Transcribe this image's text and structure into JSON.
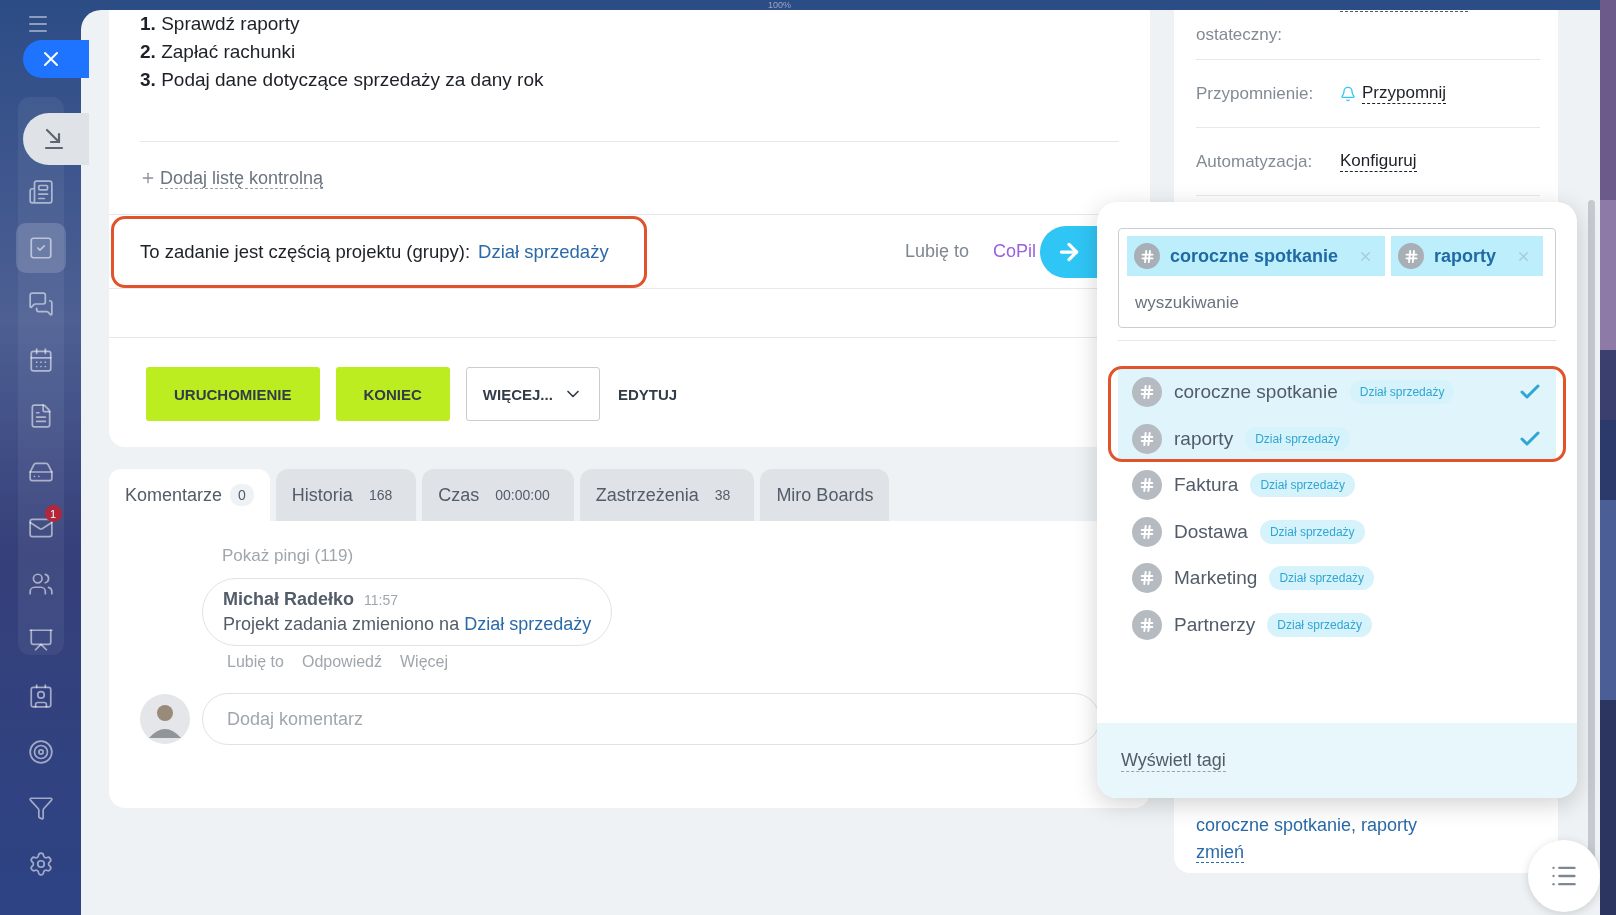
{
  "zoom_label": "100%",
  "sidebar": {
    "items": [
      {
        "selected": false
      },
      {
        "selected": true
      },
      {
        "selected": false
      },
      {
        "selected": false
      },
      {
        "selected": false
      },
      {
        "selected": false
      },
      {
        "selected": false,
        "badge": "1"
      },
      {
        "selected": false
      },
      {
        "selected": false
      },
      {
        "selected": false
      },
      {
        "selected": false
      },
      {
        "selected": false
      },
      {
        "selected": false
      }
    ]
  },
  "checklist": [
    {
      "number": "1.",
      "text": "Sprawdź raporty"
    },
    {
      "number": "2.",
      "text": "Zapłać rachunki"
    },
    {
      "number": "3.",
      "text": "Podaj dane dotyczące sprzedaży za dany rok"
    }
  ],
  "add_checklist": "Dodaj listę kontrolną",
  "project": {
    "label": "To zadanie jest częścią projektu (grupy):",
    "link": "Dział sprzedaży",
    "highlighted": true
  },
  "like": "Lubię to",
  "copilot": "CoPil",
  "actions": [
    {
      "label": "URUCHOMIENIE",
      "kind": "primary"
    },
    {
      "label": "KONIEC",
      "kind": "primary"
    },
    {
      "label": "WIĘCEJ...",
      "kind": "dropdown"
    },
    {
      "label": "EDYTUJ",
      "kind": "text"
    }
  ],
  "tabs": [
    {
      "label": "Komentarze",
      "count": "0",
      "selected": true
    },
    {
      "label": "Historia",
      "count": "168",
      "selected": false
    },
    {
      "label": "Czas",
      "count": "00:00:00",
      "selected": false
    },
    {
      "label": "Zastrzeżenia",
      "count": "38",
      "selected": false
    },
    {
      "label": "Miro Boards",
      "selected": false
    }
  ],
  "comments": {
    "show_pings": "Pokaż pingi (119)",
    "items": [
      {
        "author": "Michał Radełko",
        "time": "11:57",
        "text": "Projekt zadania zmieniono na",
        "link": "Dział sprzedaży",
        "actions": [
          "Lubię to",
          "Odpowiedź",
          "Więcej"
        ]
      }
    ],
    "input_placeholder": "Dodaj komentarz"
  },
  "details": [
    {
      "kind": "deadline",
      "label": "ostateczny:"
    },
    {
      "kind": "reminder",
      "label": "Przypomnienie:",
      "value": "Przypomnij"
    },
    {
      "kind": "link",
      "label": "Automatyzacja:",
      "value": "Konfiguruj"
    }
  ],
  "tags_summary": {
    "value": "coroczne spotkanie, raporty",
    "change": "zmień"
  },
  "tag_popup": {
    "chips": [
      {
        "label": "coroczne spotkanie"
      },
      {
        "label": "raporty"
      }
    ],
    "search_placeholder": "wyszukiwanie",
    "highlight_selected": true,
    "options": [
      {
        "name": "coroczne spotkanie",
        "group": "Dział sprzedaży",
        "selected": true
      },
      {
        "name": "raporty",
        "group": "Dział sprzedaży",
        "selected": true
      },
      {
        "name": "Faktura",
        "group": "Dział sprzedaży",
        "selected": false
      },
      {
        "name": "Dostawa",
        "group": "Dział sprzedaży",
        "selected": false
      },
      {
        "name": "Marketing",
        "group": "Dział sprzedaży",
        "selected": false
      },
      {
        "name": "Partnerzy",
        "group": "Dział sprzedaży",
        "selected": false
      }
    ],
    "footer": "Wyświetl tagi"
  }
}
